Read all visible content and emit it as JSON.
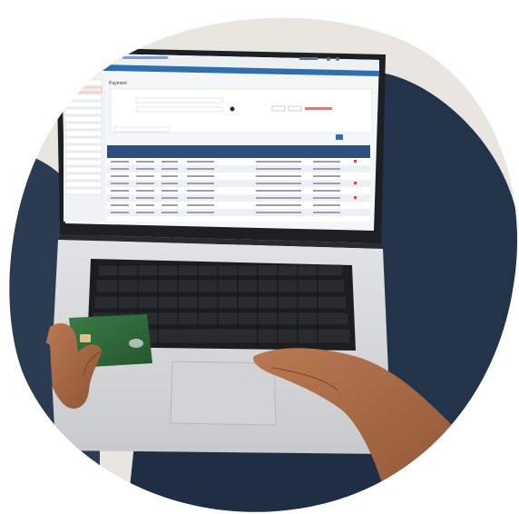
{
  "screen": {
    "app_title": "",
    "page_heading": "Payment",
    "search_button_label": "",
    "table_rows_count_shown": 9
  },
  "card": {
    "brand_mark": "",
    "number": ""
  },
  "colors": {
    "background_blob": "#e8eef4",
    "laptop_body": "#d9dadc",
    "screen_bezel": "#1e1f22",
    "screen_header": "#2f6fb0",
    "table_header": "#2c4f80",
    "card_green": "#2f6a3a",
    "jeans": "#22334a",
    "skin": "#a86a43"
  },
  "icons": {
    "sidebar_logo": "app-logo-icon",
    "keyboard": "keyboard-icon",
    "trackpad": "trackpad-icon"
  }
}
